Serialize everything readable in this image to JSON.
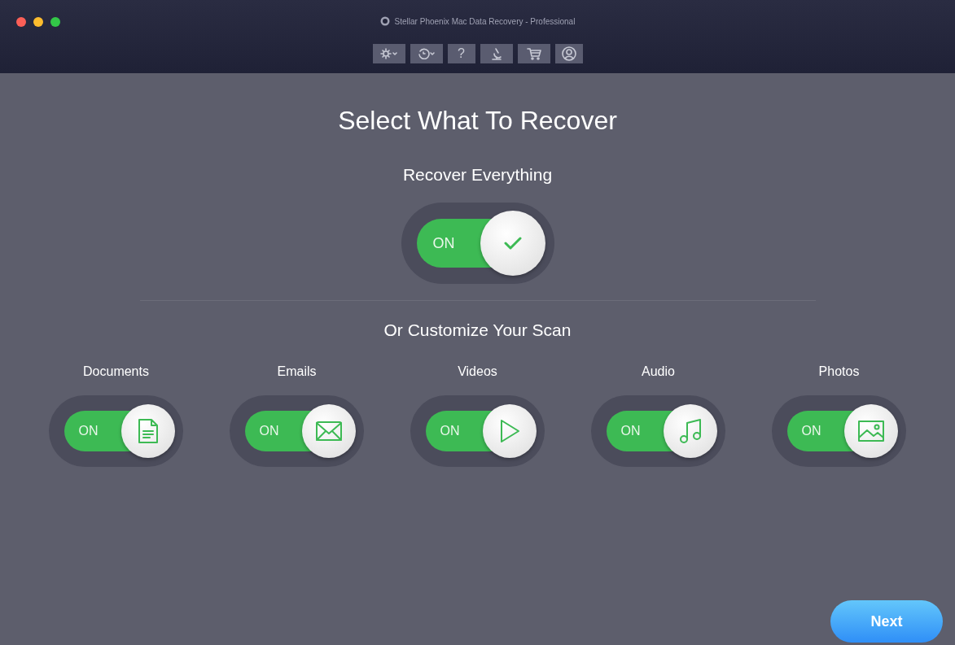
{
  "window": {
    "title": "Stellar Phoenix Mac Data Recovery - Professional"
  },
  "toolbar": [
    {
      "kind": "settings"
    },
    {
      "kind": "history"
    },
    {
      "kind": "help",
      "label": "?"
    },
    {
      "kind": "microscope"
    },
    {
      "kind": "cart"
    },
    {
      "kind": "account"
    }
  ],
  "heading": "Select What To Recover",
  "recover_everything": {
    "label": "Recover Everything",
    "toggle_label": "ON",
    "on": true
  },
  "customize_heading": "Or Customize Your Scan",
  "categories": [
    {
      "kind": "document",
      "label": "Documents",
      "toggle_label": "ON",
      "on": true
    },
    {
      "kind": "email",
      "label": "Emails",
      "toggle_label": "ON",
      "on": true
    },
    {
      "kind": "video",
      "label": "Videos",
      "toggle_label": "ON",
      "on": true
    },
    {
      "kind": "audio",
      "label": "Audio",
      "toggle_label": "ON",
      "on": true
    },
    {
      "kind": "photo",
      "label": "Photos",
      "toggle_label": "ON",
      "on": true
    }
  ],
  "next_button": "Next"
}
